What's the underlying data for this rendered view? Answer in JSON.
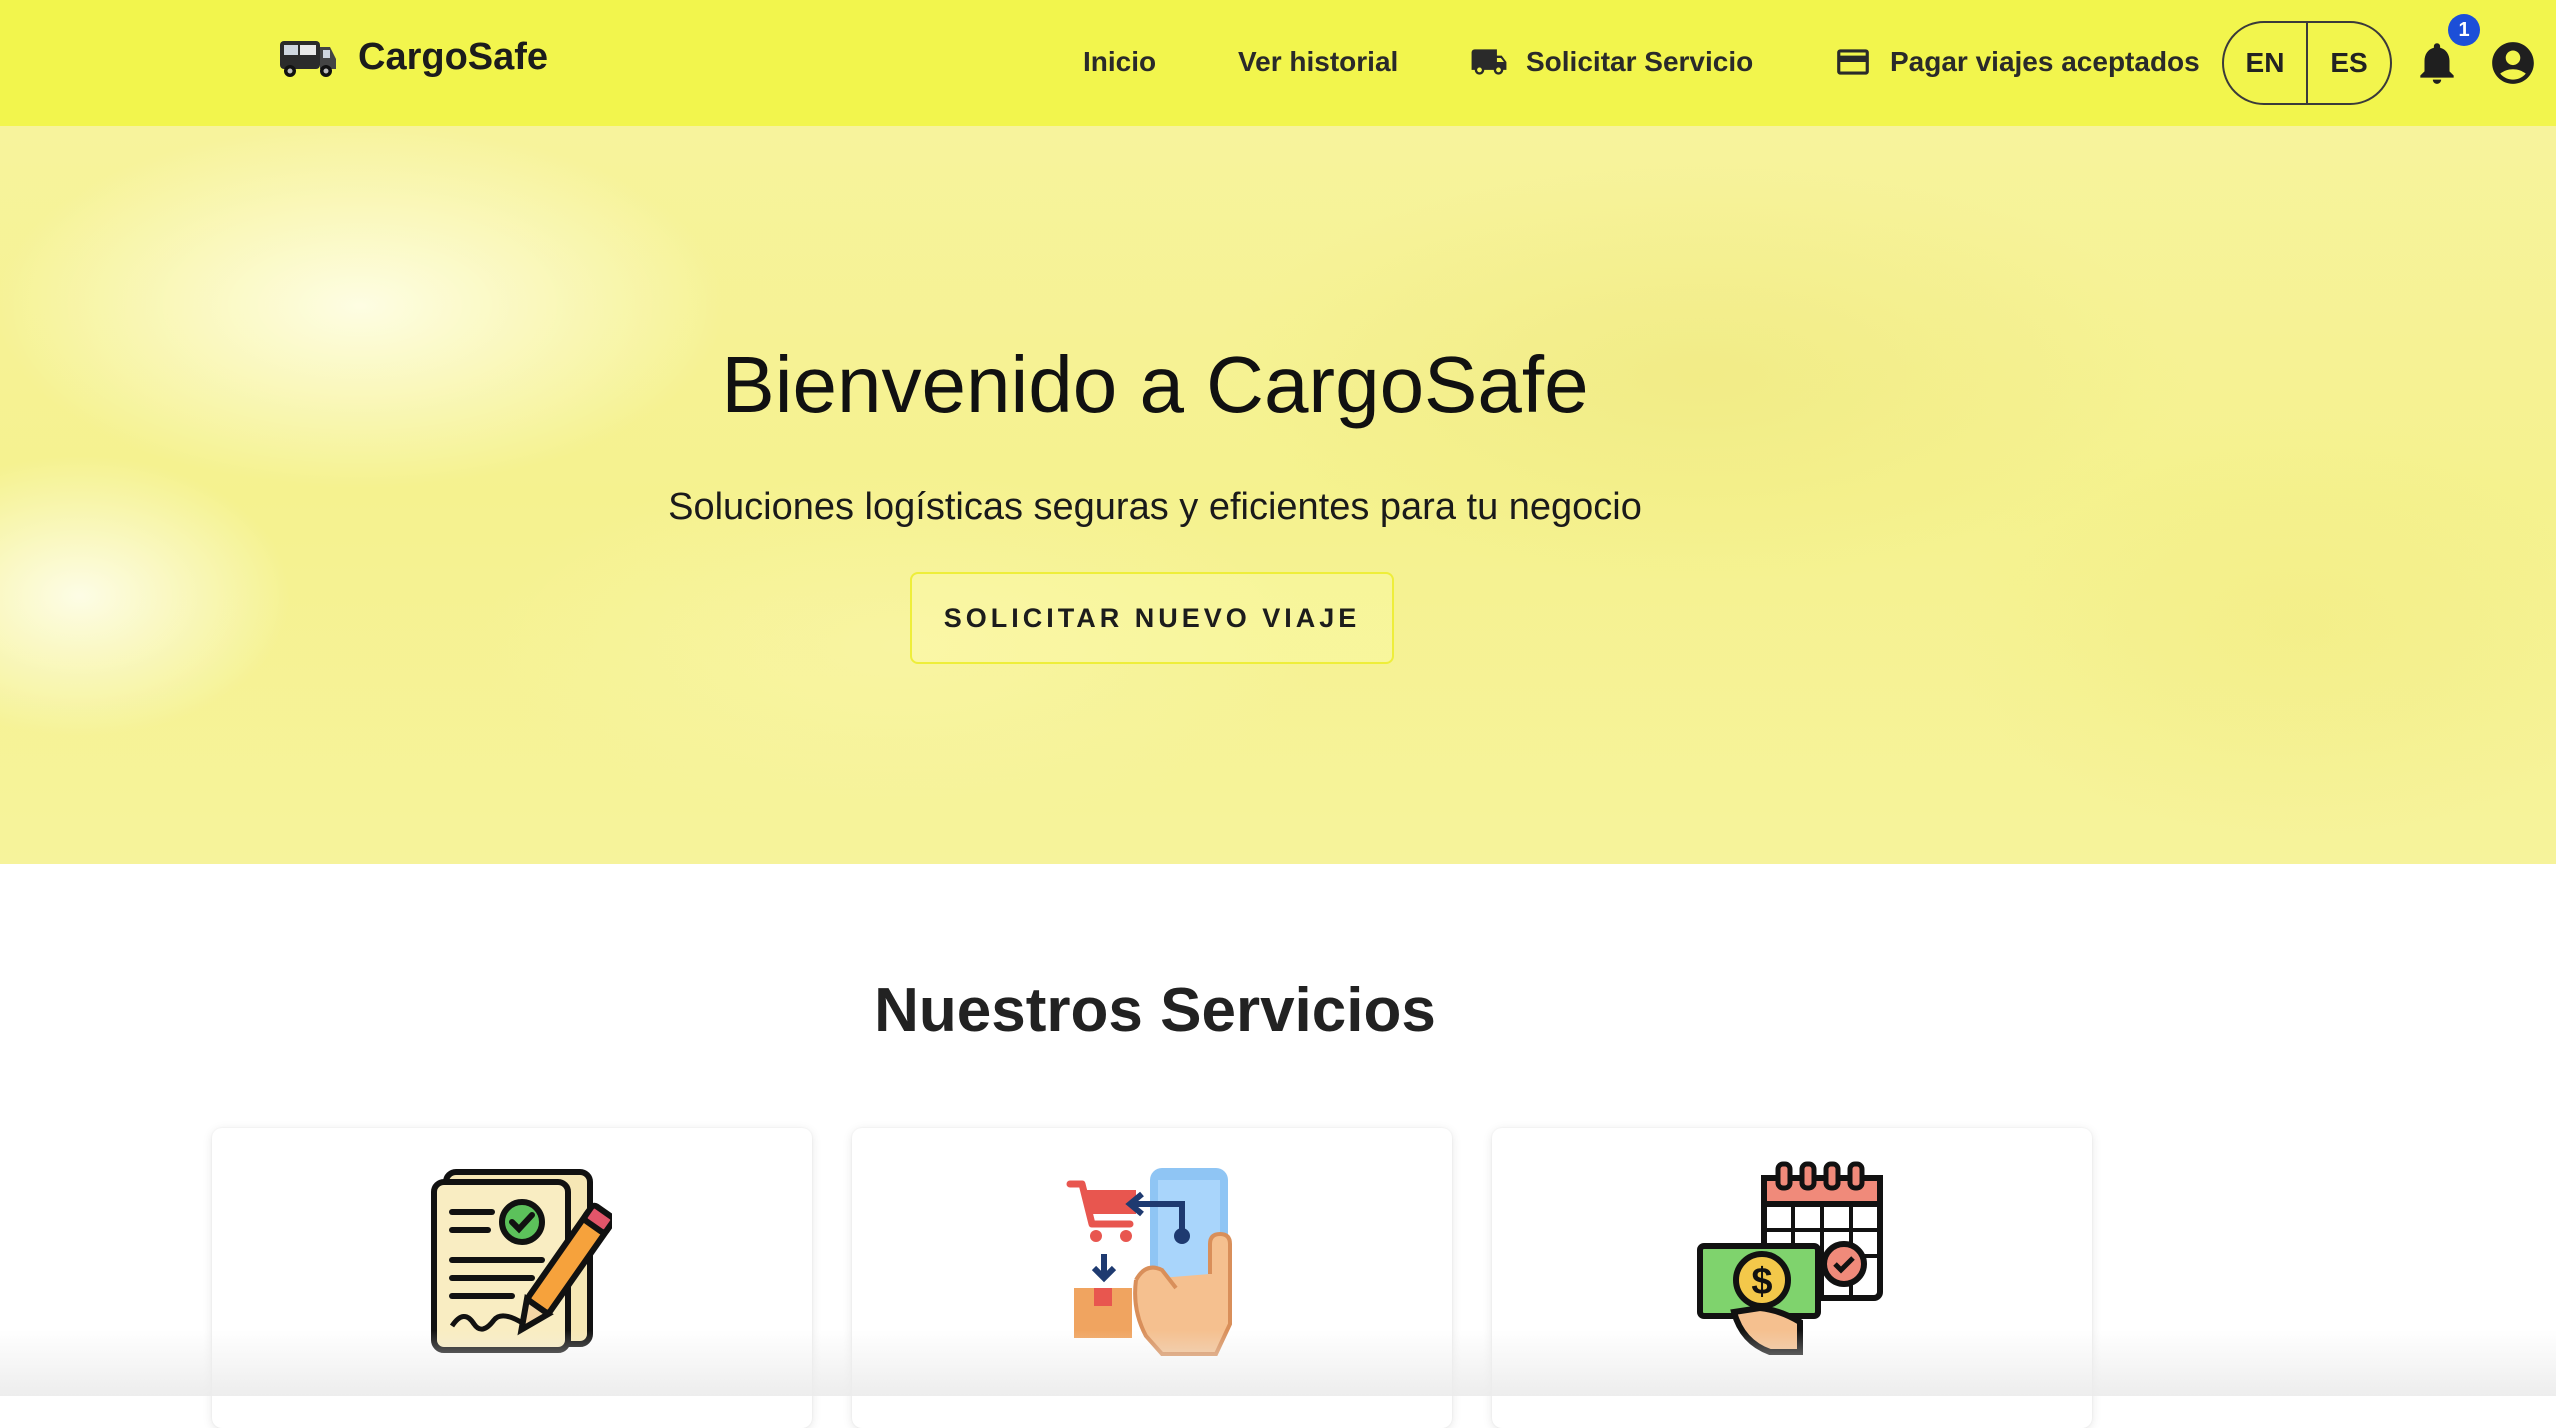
{
  "navbar": {
    "brand": "CargoSafe",
    "links": [
      {
        "label": "Inicio",
        "icon": null
      },
      {
        "label": "Ver historial",
        "icon": null
      },
      {
        "label": "Solicitar Servicio",
        "icon": "truck-icon"
      },
      {
        "label": "Pagar viajes aceptados",
        "icon": "credit-card-icon"
      }
    ],
    "languages": [
      "EN",
      "ES"
    ],
    "notification_count": "1",
    "background_color": "#f2f54d"
  },
  "hero": {
    "title": "Bienvenido a CargoSafe",
    "subtitle": "Soluciones logísticas seguras y eficientes para tu negocio",
    "cta_label": "SOLICITAR NUEVO VIAJE"
  },
  "services": {
    "title": "Nuestros Servicios",
    "cards": [
      {
        "icon": "contract-signing-icon"
      },
      {
        "icon": "mobile-order-icon"
      },
      {
        "icon": "payment-schedule-icon"
      }
    ]
  }
}
